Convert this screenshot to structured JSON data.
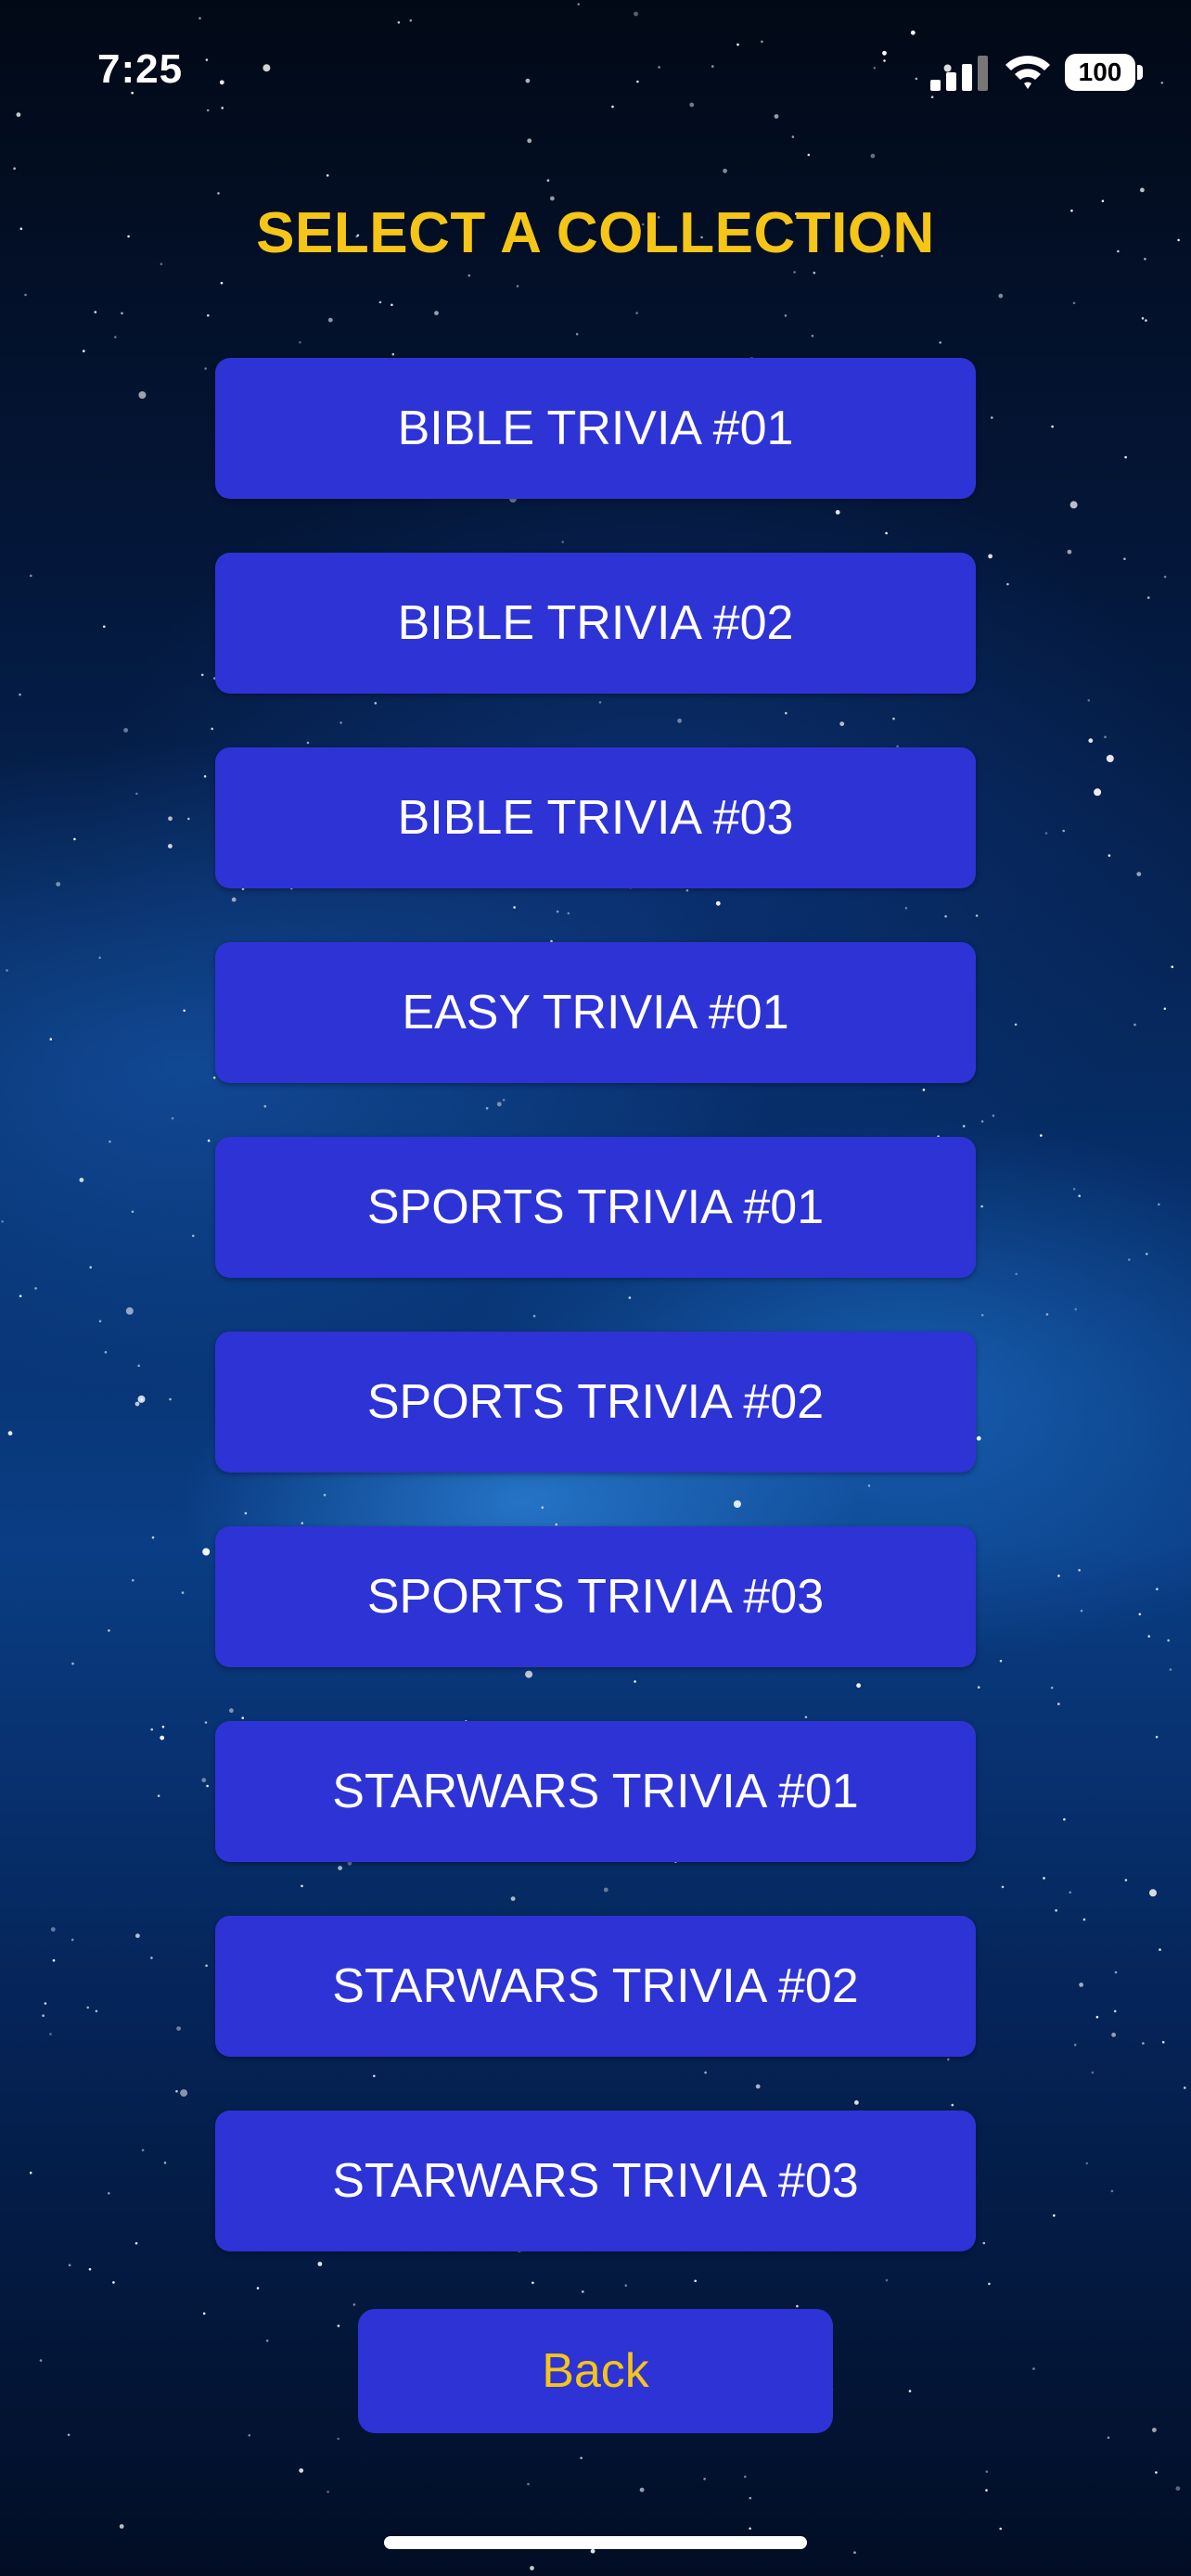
{
  "status_bar": {
    "time": "7:25",
    "battery": "100",
    "icons": [
      "signal-icon",
      "wifi-icon",
      "battery-icon"
    ]
  },
  "page": {
    "title": "SELECT A COLLECTION"
  },
  "collections": [
    "BIBLE TRIVIA #01",
    "BIBLE TRIVIA #02",
    "BIBLE TRIVIA #03",
    "EASY TRIVIA #01",
    "SPORTS TRIVIA #01",
    "SPORTS TRIVIA #02",
    "SPORTS TRIVIA #03",
    "STARWARS TRIVIA #01",
    "STARWARS TRIVIA #02",
    "STARWARS TRIVIA #03"
  ],
  "back_label": "Back",
  "colors": {
    "title": "#f5c518",
    "button_bg": "#2e33d6",
    "button_text": "#ffffff",
    "back_text": "#f5c518",
    "background": "#07306d"
  }
}
